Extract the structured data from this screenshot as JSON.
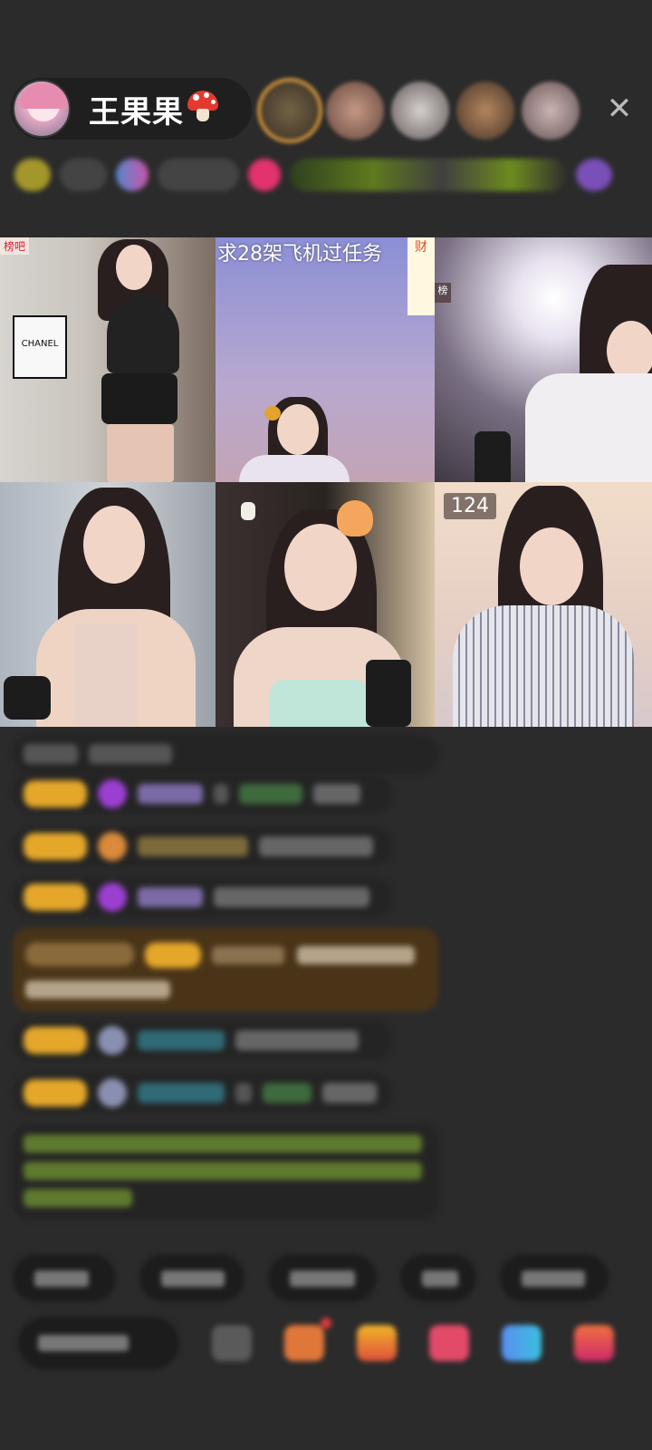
{
  "header": {
    "host_name": "王果果",
    "close_symbol": "✕",
    "viewer_avatars": [
      "viewer-1",
      "viewer-2",
      "viewer-3",
      "viewer-4",
      "viewer-5"
    ]
  },
  "grid": {
    "tiles": [
      {
        "label": "",
        "tag": "榜吧",
        "poster": "CHANEL"
      },
      {
        "label": "求28架飞机过任务",
        "corner": "财"
      },
      {
        "label": "",
        "side": "榜"
      },
      {
        "label": ""
      },
      {
        "label": ""
      },
      {
        "label": "124"
      }
    ]
  },
  "colors": {
    "background": "#2b2b2b",
    "level_badge": "#e4a72a",
    "chat_bubble": "#242424",
    "highlight_bubble": "#4a3418"
  },
  "icons": [
    "mushroom-icon",
    "close-icon",
    "gift-icon",
    "emoji-icon",
    "share-icon"
  ]
}
